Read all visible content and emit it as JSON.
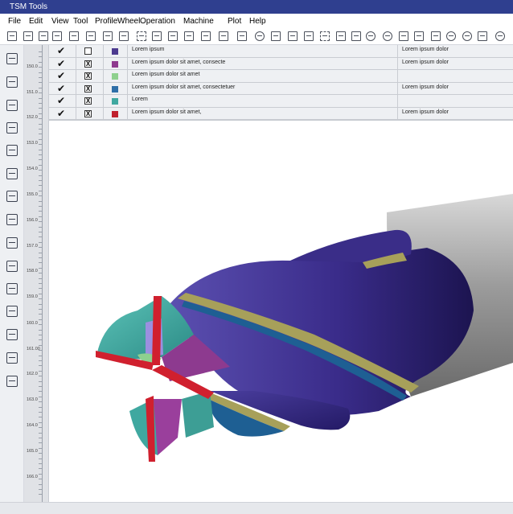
{
  "window": {
    "title": "TSM Tools"
  },
  "menu": [
    "File",
    "Edit",
    "View",
    "Tool",
    "Profile",
    "Wheel",
    "Operation",
    "Machine",
    "Plot",
    "Help"
  ],
  "toolbar_icons": [
    "new-file-icon",
    "open-file-icon",
    "grid-icon",
    "table-icon",
    "table-icon",
    "table-icon",
    "table-icon",
    "table-icon",
    "node-icon",
    "crop-icon",
    "ruler-icon",
    "flag-icon",
    "comment-icon",
    "vector-icon",
    "pointer-icon",
    "move-icon",
    "expand-icon",
    "import-icon",
    "export-icon",
    "frame-icon",
    "rotate-icon",
    "transform-icon",
    "cloud-download-icon",
    "cloud-upload-icon",
    "lock-icon",
    "lock-icon",
    "link-icon",
    "settings-icon",
    "gears-icon",
    "copy-icon",
    "reset-icon"
  ],
  "sidebar_icons": [
    "dashboard-icon",
    "text-tool-icon",
    "bottle-icon",
    "document-edit-icon",
    "add-window-icon",
    "layout-icon",
    "calendar-icon",
    "machine-icon",
    "grinder-icon",
    "tools-icon",
    "user-profile-icon",
    "direction-icon",
    "bar-chart-icon",
    "bookmark-icon",
    "scissors-icon"
  ],
  "ruler_labels": [
    "150.0",
    "151.0",
    "152.0",
    "153.0",
    "154.0",
    "155.0",
    "156.0",
    "157.0",
    "158.0",
    "159.0",
    "160.0",
    "161.00",
    "162.0",
    "163.0",
    "164.0",
    "165.0",
    "166.0"
  ],
  "table": {
    "rows": [
      {
        "checked": true,
        "box": "",
        "color": "#4c3a8f",
        "description": "Lorem ipsum",
        "note": "Lorem ipsum dolor"
      },
      {
        "checked": true,
        "box": "X",
        "color": "#8e3a8e",
        "description": "Lorem ipsum dolor sit amet, consecte",
        "note": "Lorem ipsum dolor"
      },
      {
        "checked": true,
        "box": "X",
        "color": "#8ed08e",
        "description": "Lorem ipsum dolor sit amet",
        "note": ""
      },
      {
        "checked": true,
        "box": "X",
        "color": "#2f6fa8",
        "description": "Lorem ipsum dolor sit amet, consectetuer",
        "note": "Lorem ipsum dolor"
      },
      {
        "checked": true,
        "box": "X",
        "color": "#3fa8a0",
        "description": "Lorem",
        "note": ""
      },
      {
        "checked": true,
        "box": "X",
        "color": "#c0202e",
        "description": "Lorem ipsum dolor sit amet,",
        "note": "Lorem ipsum dolor"
      }
    ]
  },
  "colors": {
    "titlebar": "#2f3f8f",
    "tool_body": "#3d2f8c",
    "tool_edge": "#6a3c9a",
    "flute": "#a7a05a",
    "cutting_edge": "#d0202e",
    "tip_face": "#3aa59c",
    "shank": "#9a9a9a"
  }
}
